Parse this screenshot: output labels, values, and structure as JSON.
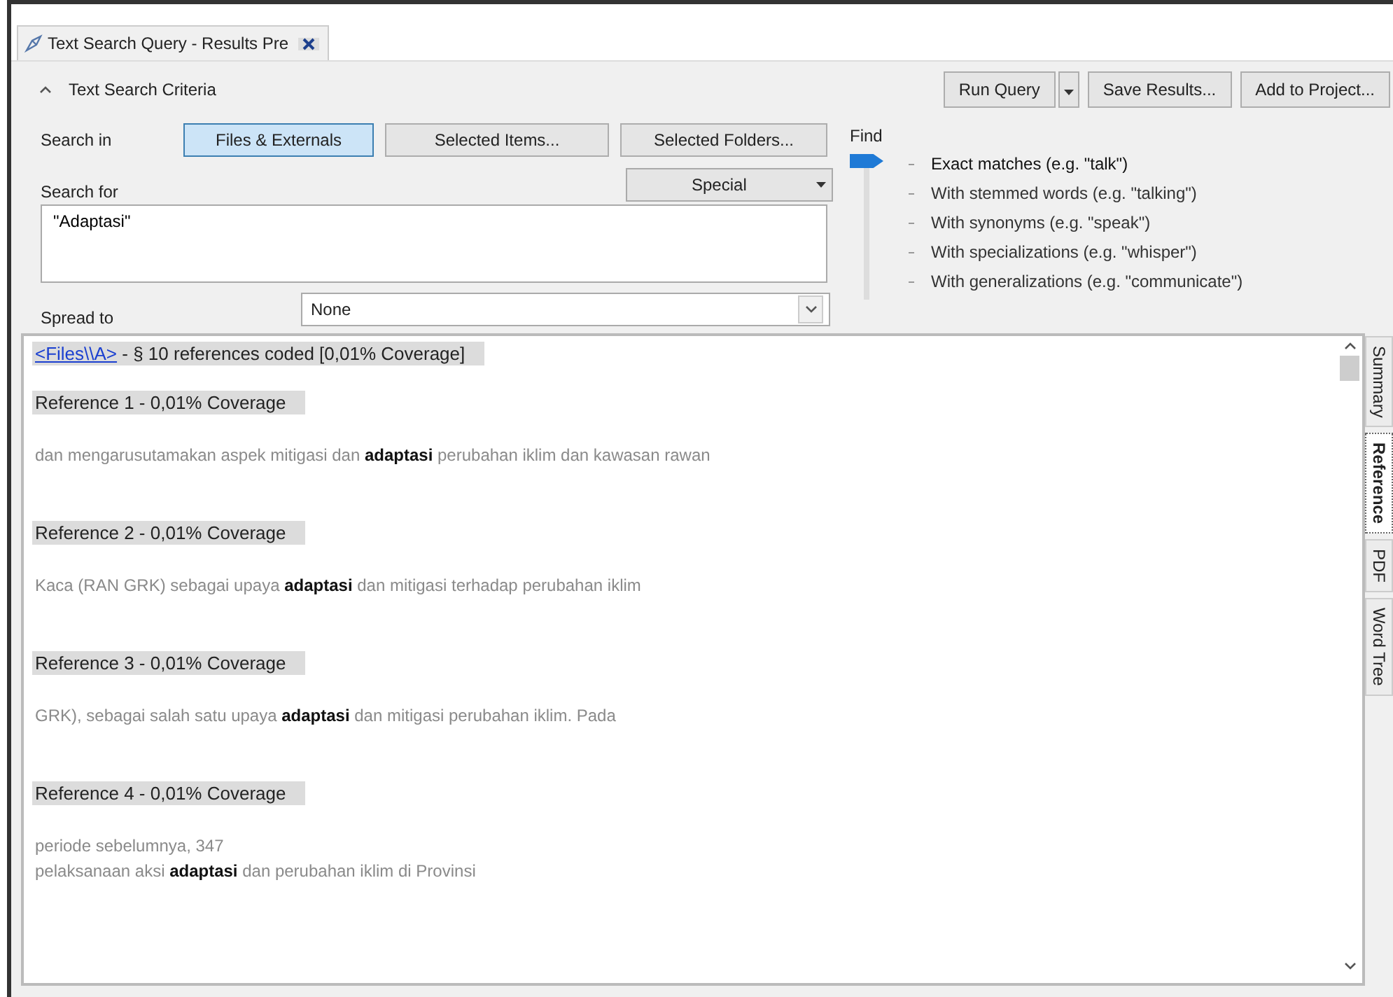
{
  "document_tab": {
    "title": "Text Search Query - Results Pre"
  },
  "criteria": {
    "title": "Text Search Criteria",
    "expanded": true,
    "search_in": {
      "label": "Search in",
      "options": [
        {
          "label": "Files & Externals",
          "selected": true
        },
        {
          "label": "Selected Items...",
          "selected": false
        },
        {
          "label": "Selected Folders...",
          "selected": false
        }
      ]
    },
    "search_for": {
      "label": "Search for",
      "value": "\"Adaptasi\"",
      "special": "Special"
    },
    "spread_to": {
      "label": "Spread to",
      "value": "None"
    },
    "find": {
      "label": "Find",
      "options": [
        {
          "label": "Exact matches (e.g. \"talk\")",
          "selected": true
        },
        {
          "label": "With stemmed words (e.g. \"talking\")",
          "selected": false
        },
        {
          "label": "With synonyms (e.g. \"speak\")",
          "selected": false
        },
        {
          "label": "With specializations (e.g. \"whisper\")",
          "selected": false
        },
        {
          "label": "With generalizations (e.g. \"communicate\")",
          "selected": false
        }
      ]
    }
  },
  "toolbar": {
    "run": "Run Query",
    "save": "Save Results...",
    "add": "Add to Project..."
  },
  "results": {
    "file_link": "<Files\\\\A>",
    "summary": " - § 10 references coded  [0,01% Coverage]",
    "references": [
      {
        "heading": "Reference 1 - 0,01% Coverage",
        "lines": [
          "dan mengarusutamakan aspek mitigasi dan **adaptasi** perubahan iklim dan kawasan rawan"
        ]
      },
      {
        "heading": "Reference 2 - 0,01% Coverage",
        "lines": [
          "Kaca (RAN GRK) sebagai upaya **adaptasi** dan mitigasi terhadap perubahan iklim"
        ]
      },
      {
        "heading": "Reference 3 - 0,01% Coverage",
        "lines": [
          "GRK), sebagai salah satu upaya **adaptasi** dan mitigasi perubahan iklim. Pada"
        ]
      },
      {
        "heading": "Reference 4 - 0,01% Coverage",
        "lines": [
          "periode sebelumnya, 347",
          "pelaksanaan aksi **adaptasi** dan perubahan iklim di Provinsi"
        ]
      }
    ]
  },
  "side_tabs": [
    {
      "label": "Summary",
      "selected": false
    },
    {
      "label": "Reference",
      "selected": true
    },
    {
      "label": "PDF",
      "selected": false
    },
    {
      "label": "Word Tree",
      "selected": false
    }
  ]
}
